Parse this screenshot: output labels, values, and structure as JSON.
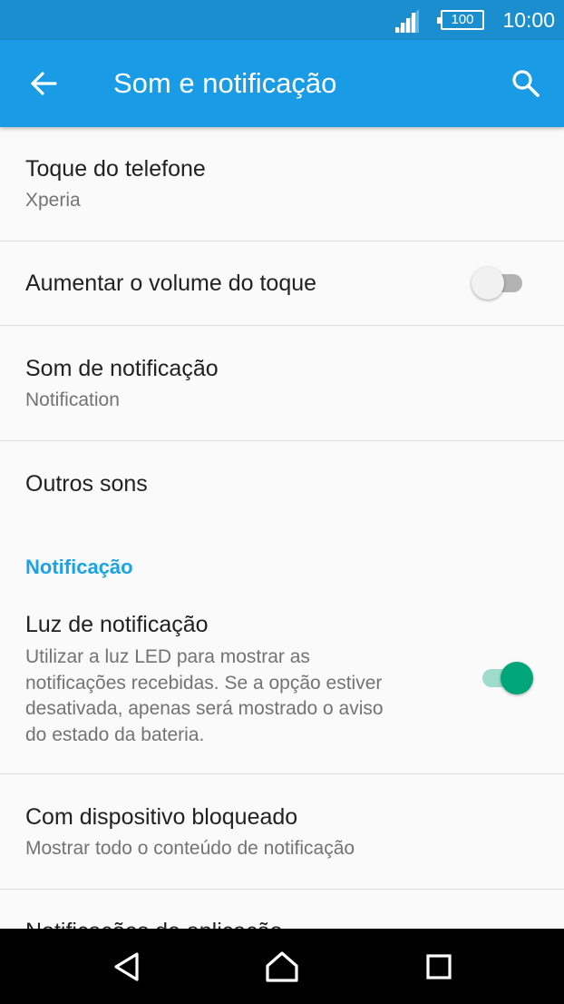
{
  "status_bar": {
    "battery": "100",
    "time": "10:00"
  },
  "app_bar": {
    "title": "Som e notificação"
  },
  "settings": {
    "ringtone": {
      "title": "Toque do telefone",
      "summary": "Xperia"
    },
    "increasing_ring": {
      "title": "Aumentar o volume do toque",
      "enabled": false
    },
    "notification_sound": {
      "title": "Som de notificação",
      "summary": "Notification"
    },
    "other_sounds": {
      "title": "Outros sons"
    },
    "notification_section": {
      "header": "Notificação"
    },
    "notification_light": {
      "title": "Luz de notificação",
      "summary_lines": [
        "Utilizar a luz LED para mostrar as",
        "notificações recebidas. Se a opção estiver",
        "desativada, apenas será mostrado o aviso",
        "do estado da bateria."
      ],
      "enabled": true
    },
    "lock_screen": {
      "title": "Com dispositivo bloqueado",
      "summary": "Mostrar todo o conteúdo de notificação"
    },
    "app_notifications": {
      "title": "Notificações de aplicação"
    }
  },
  "colors": {
    "status_bar": "#1b8ecf",
    "app_bar": "#1a9be6",
    "accent": "#1aa3e6",
    "switch_on": "#00a57a"
  },
  "icons": {
    "back": "arrow-left-icon",
    "search": "search-icon",
    "signal": "signal-icon",
    "battery": "battery-icon",
    "nav_back": "triangle-back-icon",
    "nav_home": "home-icon",
    "nav_recents": "square-recents-icon"
  }
}
